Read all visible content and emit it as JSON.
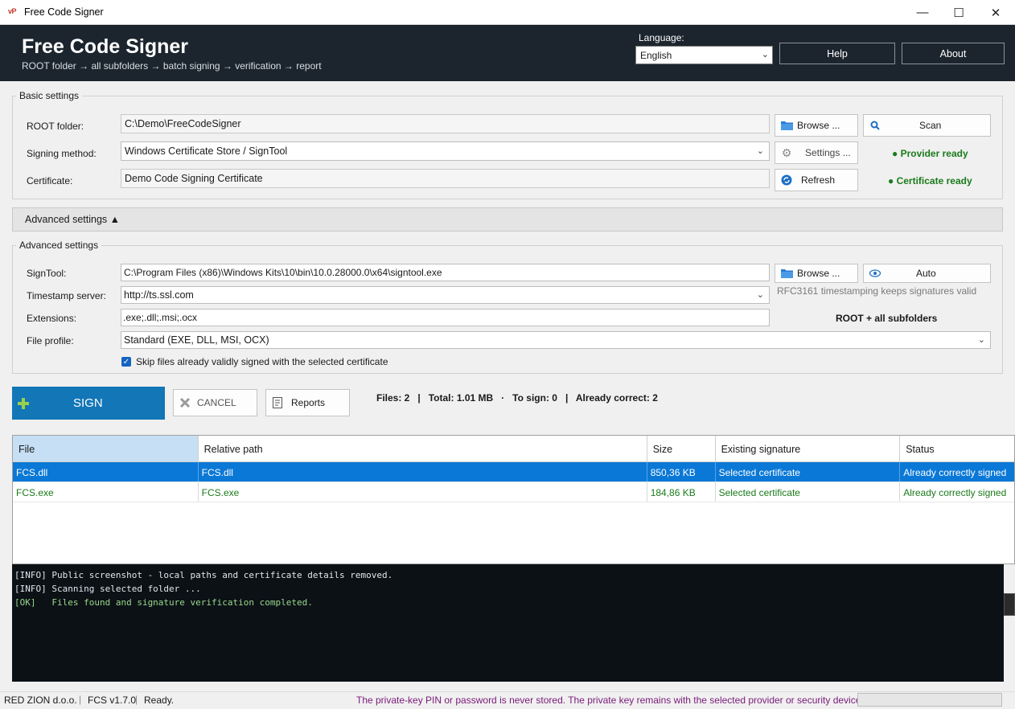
{
  "window": {
    "icon_text": "vP",
    "title": "Free Code Signer",
    "controls": {
      "minimize": "—",
      "maximize": "☐",
      "close": "✕"
    }
  },
  "header": {
    "title": "Free Code Signer",
    "subtitle": "ROOT folder → all subfolders → batch signing → verification → report",
    "language_label": "Language:",
    "language_value": "English",
    "help_label": "Help",
    "about_label": "About"
  },
  "basic": {
    "group_title": "Basic settings",
    "root_label": "ROOT folder:",
    "root_value": "C:\\Demo\\FreeCodeSigner",
    "browse_label": "Browse ...",
    "scan_label": "Scan",
    "method_label": "Signing method:",
    "method_value": "Windows Certificate Store / SignTool",
    "settings_label": "Settings ...",
    "provider_status": "● Provider ready",
    "cert_label": "Certificate:",
    "cert_value": "Demo Code Signing Certificate",
    "refresh_label": "Refresh",
    "cert_status": "● Certificate ready"
  },
  "advanced_toggle": {
    "label": "Advanced settings ▲"
  },
  "advanced": {
    "group_title": "Advanced settings",
    "signtool_label": "SignTool:",
    "signtool_value": "C:\\Program Files (x86)\\Windows Kits\\10\\bin\\10.0.28000.0\\x64\\signtool.exe",
    "browse_label": "Browse ...",
    "auto_label": "Auto",
    "timestamp_label": "Timestamp server:",
    "timestamp_value": "http://ts.ssl.com",
    "timestamp_note": "RFC3161 timestamping keeps signatures valid",
    "extensions_label": "Extensions:",
    "extensions_value": ".exe;.dll;.msi;.ocx",
    "scope_note": "ROOT + all subfolders",
    "profile_label": "File profile:",
    "profile_value": "Standard (EXE, DLL, MSI, OCX)",
    "skip_label": "Skip files already validly signed with the selected certificate",
    "skip_checked": true
  },
  "actions": {
    "sign_label": "SIGN",
    "cancel_label": "CANCEL",
    "reports_label": "Reports",
    "stats": "Files: 2   |   Total: 1.01 MB   ·   To sign: 0   |   Already correct: 2"
  },
  "table": {
    "columns": [
      "File",
      "Relative path",
      "Size",
      "Existing signature",
      "Status"
    ],
    "rows": [
      [
        "FCS.dll",
        "FCS.dll",
        "850,36 KB",
        "Selected certificate",
        "Already correctly signed"
      ],
      [
        "FCS.exe",
        "FCS.exe",
        "184,86 KB",
        "Selected certificate",
        "Already correctly signed"
      ]
    ]
  },
  "log": {
    "lines": [
      {
        "text": "[INFO] Public screenshot - local paths and certificate details removed.",
        "level": "info"
      },
      {
        "text": "[INFO] Scanning selected folder ...",
        "level": "info"
      },
      {
        "text": "[OK]   Files found and signature verification completed.",
        "level": "ok"
      }
    ]
  },
  "statusbar": {
    "company": "RED ZION d.o.o.",
    "version": "FCS v1.7.0",
    "state": "Ready.",
    "message": "The private-key PIN or password is never stored. The private key remains with the selected provider or security device."
  },
  "colors": {
    "header_bg": "#1c252e",
    "accent": "#1276b7",
    "selection": "#0a78d6",
    "ok_green": "#1a7a1a",
    "message_purple": "#7a1a7a"
  }
}
